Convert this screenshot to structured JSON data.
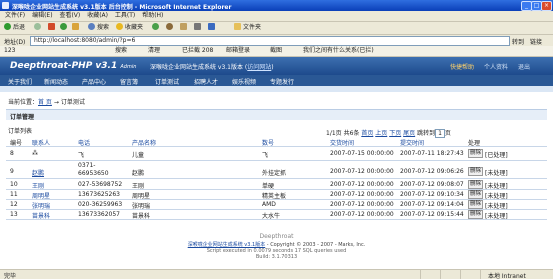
{
  "window": {
    "title": "深喉咙企业网站生成系统 v3.1版本 后台控制 - Microsoft Internet Explorer",
    "min": "_",
    "max": "□",
    "close": "×"
  },
  "menu": [
    "文件(F)",
    "编辑(E)",
    "查看(V)",
    "收藏(A)",
    "工具(T)",
    "帮助(H)"
  ],
  "toolbar": {
    "back": "后退",
    "search": "搜索",
    "favorites": "收藏夹",
    "folders": "文件夹"
  },
  "address": {
    "label": "地址(D)",
    "url": "http://localhost:8080/admin/?p=6",
    "go": "转到",
    "links": "链接"
  },
  "toolbar2": {
    "items": [
      "123",
      "搜索",
      "清理",
      "已拦截 208",
      "邮箱登录",
      "截图",
      "我们之间有什么关系(已拦)"
    ]
  },
  "app": {
    "logo": "Deepthroat-PHP v3.1",
    "logo_sub": "Admin",
    "system_name": "深喉咙企业网站生成系统 v3.1版本",
    "system_link": "访问网站",
    "top_links": [
      "快捷帮助",
      "个人资料",
      "退出"
    ],
    "accent": "#2a5895"
  },
  "nav": [
    "关于我们",
    "新闻动态",
    "产品中心",
    "留言簿",
    "订单测试",
    "招聘人才",
    "娱乐视频",
    "专题发行"
  ],
  "breadcrumb": {
    "prefix": "当前位置：",
    "home": "首 页",
    "sep": "→",
    "current": "订单测试"
  },
  "section_title": "订单管理",
  "list_title": "订单列表",
  "pager": {
    "info": "1/1页 共6条",
    "first": "首页",
    "prev": "上页",
    "next": "下页",
    "last": "尾页",
    "jump_label": "跳转到",
    "jump_value": "1",
    "page_suffix": "页"
  },
  "table": {
    "headers": [
      "编号",
      "联系人",
      "电话",
      "产品名称",
      "数号",
      "交货时间",
      "提交时间",
      "处理"
    ],
    "rows": [
      {
        "id": "8",
        "contact": "⁂",
        "phone": "飞",
        "product": "儿童",
        "qty": "飞",
        "delivery": "2007-07-15 00:00:00",
        "submitted": "2007-07-11 18:27:43",
        "action": "删除",
        "status": "[已处理]"
      },
      {
        "id": "9",
        "contact": "赵鹏",
        "phone": "0371-66953650",
        "product": "赵鹏",
        "qty": "外挂定抓",
        "delivery": "2007-07-12 00:00:00",
        "submitted": "2007-07-12 09:06:26",
        "action": "删除",
        "status": "[未处理]"
      },
      {
        "id": "10",
        "contact": "王刚",
        "phone": "027-53698752",
        "product": "王刚",
        "qty": "单硬",
        "delivery": "2007-07-12 00:00:00",
        "submitted": "2007-07-12 09:08:07",
        "action": "删除",
        "status": "[未处理]"
      },
      {
        "id": "11",
        "contact": "周明星",
        "phone": "13673625263",
        "product": "周明星",
        "qty": "精英主板",
        "delivery": "2007-07-12 00:00:00",
        "submitted": "2007-07-12 09:10:34",
        "action": "删除",
        "status": "[未处理]"
      },
      {
        "id": "12",
        "contact": "张明瑞",
        "phone": "020-36259963",
        "product": "张明瑞",
        "qty": "AMD",
        "delivery": "2007-07-12 00:00:00",
        "submitted": "2007-07-12 09:14:04",
        "action": "删除",
        "status": "[未处理]"
      },
      {
        "id": "13",
        "contact": "苗景科",
        "phone": "13673362057",
        "product": "苗景科",
        "qty": "大水牛",
        "delivery": "2007-07-12 00:00:00",
        "submitted": "2007-07-12 09:15:44",
        "action": "删除",
        "status": "[未处理]"
      }
    ]
  },
  "footer": {
    "brand": "Deepthroat",
    "line1_link": "深喉咙企业网站生成系统 v3.1版本",
    "line1_rest": "- Copyright © 2003 - 2007 - Marks, Inc.",
    "line2": "Script executed in 0.0079 seconds 17 SQL queries used",
    "line3": "Build: 3.1.70313"
  },
  "statusbar": {
    "left": "完毕",
    "zone": "本地 Intranet"
  }
}
